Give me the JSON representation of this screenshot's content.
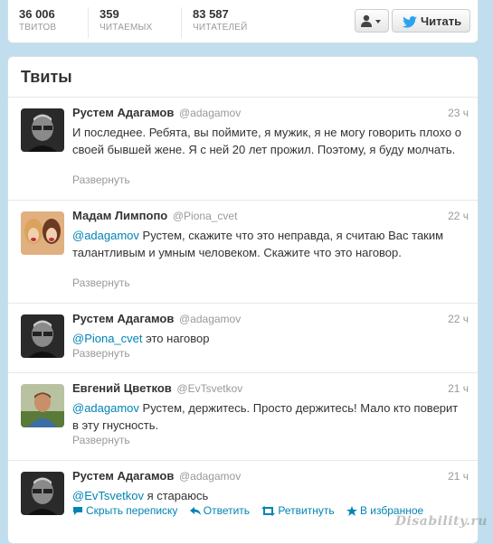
{
  "profile_stats": {
    "tweets": {
      "value": "36 006",
      "label": "ТВИТОВ"
    },
    "following": {
      "value": "359",
      "label": "ЧИТАЕМЫХ"
    },
    "followers": {
      "value": "83 587",
      "label": "ЧИТАТЕЛЕЙ"
    }
  },
  "actions": {
    "user_dropdown_icon": "user-icon",
    "follow_label": "Читать",
    "follow_icon": "twitter-bird-icon"
  },
  "panel": {
    "title": "Твиты"
  },
  "tweets": [
    {
      "name": "Рустем Адагамов",
      "handle": "@adagamov",
      "time": "23 ч",
      "mention": "",
      "text": "И последнее. Ребята, вы поймите, я мужик, я не могу говорить плохо о своей бывшей жене. Я с ней 20 лет прожил. Поэтому, я буду молчать.",
      "expand": "Развернуть"
    },
    {
      "name": "Мадам Лимпопо",
      "handle": "@Piona_cvet",
      "time": "22 ч",
      "mention": "@adagamov",
      "text": " Рустем, скажите что это неправда, я считаю Вас таким талантливым и умным человеком. Скажите что это наговор.",
      "expand": "Развернуть"
    },
    {
      "name": "Рустем Адагамов",
      "handle": "@adagamov",
      "time": "22 ч",
      "mention": "@Piona_cvet",
      "text": " это наговор",
      "expand": "Развернуть"
    },
    {
      "name": "Евгений Цветков",
      "handle": "@EvTsvetkov",
      "time": "21 ч",
      "mention": "@adagamov",
      "text": " Рустем, держитесь. Просто держитесь! Мало кто поверит в эту гнусность.",
      "expand": "Развернуть"
    },
    {
      "name": "Рустем Адагамов",
      "handle": "@adagamov",
      "time": "21 ч",
      "mention": "@EvTsvetkov",
      "text": " я стараюсь",
      "actions": {
        "hide": "Скрыть переписку",
        "reply": "Ответить",
        "retweet": "Ретвитнуть",
        "favorite": "В избранное"
      }
    }
  ],
  "watermark": "Disability.ru",
  "colors": {
    "link": "#0084b4",
    "background": "#c0deed",
    "muted": "#999999"
  }
}
